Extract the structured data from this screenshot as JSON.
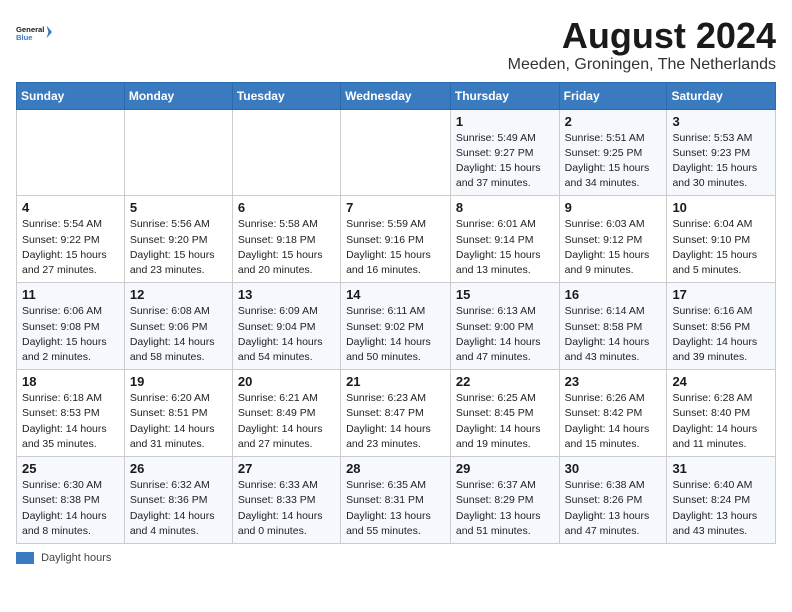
{
  "header": {
    "logo_line1": "General",
    "logo_line2": "Blue",
    "month": "August 2024",
    "location": "Meeden, Groningen, The Netherlands"
  },
  "days_of_week": [
    "Sunday",
    "Monday",
    "Tuesday",
    "Wednesday",
    "Thursday",
    "Friday",
    "Saturday"
  ],
  "footer": {
    "label": "Daylight hours"
  },
  "weeks": [
    [
      {
        "day": "",
        "info": ""
      },
      {
        "day": "",
        "info": ""
      },
      {
        "day": "",
        "info": ""
      },
      {
        "day": "",
        "info": ""
      },
      {
        "day": "1",
        "info": "Sunrise: 5:49 AM\nSunset: 9:27 PM\nDaylight: 15 hours\nand 37 minutes."
      },
      {
        "day": "2",
        "info": "Sunrise: 5:51 AM\nSunset: 9:25 PM\nDaylight: 15 hours\nand 34 minutes."
      },
      {
        "day": "3",
        "info": "Sunrise: 5:53 AM\nSunset: 9:23 PM\nDaylight: 15 hours\nand 30 minutes."
      }
    ],
    [
      {
        "day": "4",
        "info": "Sunrise: 5:54 AM\nSunset: 9:22 PM\nDaylight: 15 hours\nand 27 minutes."
      },
      {
        "day": "5",
        "info": "Sunrise: 5:56 AM\nSunset: 9:20 PM\nDaylight: 15 hours\nand 23 minutes."
      },
      {
        "day": "6",
        "info": "Sunrise: 5:58 AM\nSunset: 9:18 PM\nDaylight: 15 hours\nand 20 minutes."
      },
      {
        "day": "7",
        "info": "Sunrise: 5:59 AM\nSunset: 9:16 PM\nDaylight: 15 hours\nand 16 minutes."
      },
      {
        "day": "8",
        "info": "Sunrise: 6:01 AM\nSunset: 9:14 PM\nDaylight: 15 hours\nand 13 minutes."
      },
      {
        "day": "9",
        "info": "Sunrise: 6:03 AM\nSunset: 9:12 PM\nDaylight: 15 hours\nand 9 minutes."
      },
      {
        "day": "10",
        "info": "Sunrise: 6:04 AM\nSunset: 9:10 PM\nDaylight: 15 hours\nand 5 minutes."
      }
    ],
    [
      {
        "day": "11",
        "info": "Sunrise: 6:06 AM\nSunset: 9:08 PM\nDaylight: 15 hours\nand 2 minutes."
      },
      {
        "day": "12",
        "info": "Sunrise: 6:08 AM\nSunset: 9:06 PM\nDaylight: 14 hours\nand 58 minutes."
      },
      {
        "day": "13",
        "info": "Sunrise: 6:09 AM\nSunset: 9:04 PM\nDaylight: 14 hours\nand 54 minutes."
      },
      {
        "day": "14",
        "info": "Sunrise: 6:11 AM\nSunset: 9:02 PM\nDaylight: 14 hours\nand 50 minutes."
      },
      {
        "day": "15",
        "info": "Sunrise: 6:13 AM\nSunset: 9:00 PM\nDaylight: 14 hours\nand 47 minutes."
      },
      {
        "day": "16",
        "info": "Sunrise: 6:14 AM\nSunset: 8:58 PM\nDaylight: 14 hours\nand 43 minutes."
      },
      {
        "day": "17",
        "info": "Sunrise: 6:16 AM\nSunset: 8:56 PM\nDaylight: 14 hours\nand 39 minutes."
      }
    ],
    [
      {
        "day": "18",
        "info": "Sunrise: 6:18 AM\nSunset: 8:53 PM\nDaylight: 14 hours\nand 35 minutes."
      },
      {
        "day": "19",
        "info": "Sunrise: 6:20 AM\nSunset: 8:51 PM\nDaylight: 14 hours\nand 31 minutes."
      },
      {
        "day": "20",
        "info": "Sunrise: 6:21 AM\nSunset: 8:49 PM\nDaylight: 14 hours\nand 27 minutes."
      },
      {
        "day": "21",
        "info": "Sunrise: 6:23 AM\nSunset: 8:47 PM\nDaylight: 14 hours\nand 23 minutes."
      },
      {
        "day": "22",
        "info": "Sunrise: 6:25 AM\nSunset: 8:45 PM\nDaylight: 14 hours\nand 19 minutes."
      },
      {
        "day": "23",
        "info": "Sunrise: 6:26 AM\nSunset: 8:42 PM\nDaylight: 14 hours\nand 15 minutes."
      },
      {
        "day": "24",
        "info": "Sunrise: 6:28 AM\nSunset: 8:40 PM\nDaylight: 14 hours\nand 11 minutes."
      }
    ],
    [
      {
        "day": "25",
        "info": "Sunrise: 6:30 AM\nSunset: 8:38 PM\nDaylight: 14 hours\nand 8 minutes."
      },
      {
        "day": "26",
        "info": "Sunrise: 6:32 AM\nSunset: 8:36 PM\nDaylight: 14 hours\nand 4 minutes."
      },
      {
        "day": "27",
        "info": "Sunrise: 6:33 AM\nSunset: 8:33 PM\nDaylight: 14 hours\nand 0 minutes."
      },
      {
        "day": "28",
        "info": "Sunrise: 6:35 AM\nSunset: 8:31 PM\nDaylight: 13 hours\nand 55 minutes."
      },
      {
        "day": "29",
        "info": "Sunrise: 6:37 AM\nSunset: 8:29 PM\nDaylight: 13 hours\nand 51 minutes."
      },
      {
        "day": "30",
        "info": "Sunrise: 6:38 AM\nSunset: 8:26 PM\nDaylight: 13 hours\nand 47 minutes."
      },
      {
        "day": "31",
        "info": "Sunrise: 6:40 AM\nSunset: 8:24 PM\nDaylight: 13 hours\nand 43 minutes."
      }
    ]
  ]
}
